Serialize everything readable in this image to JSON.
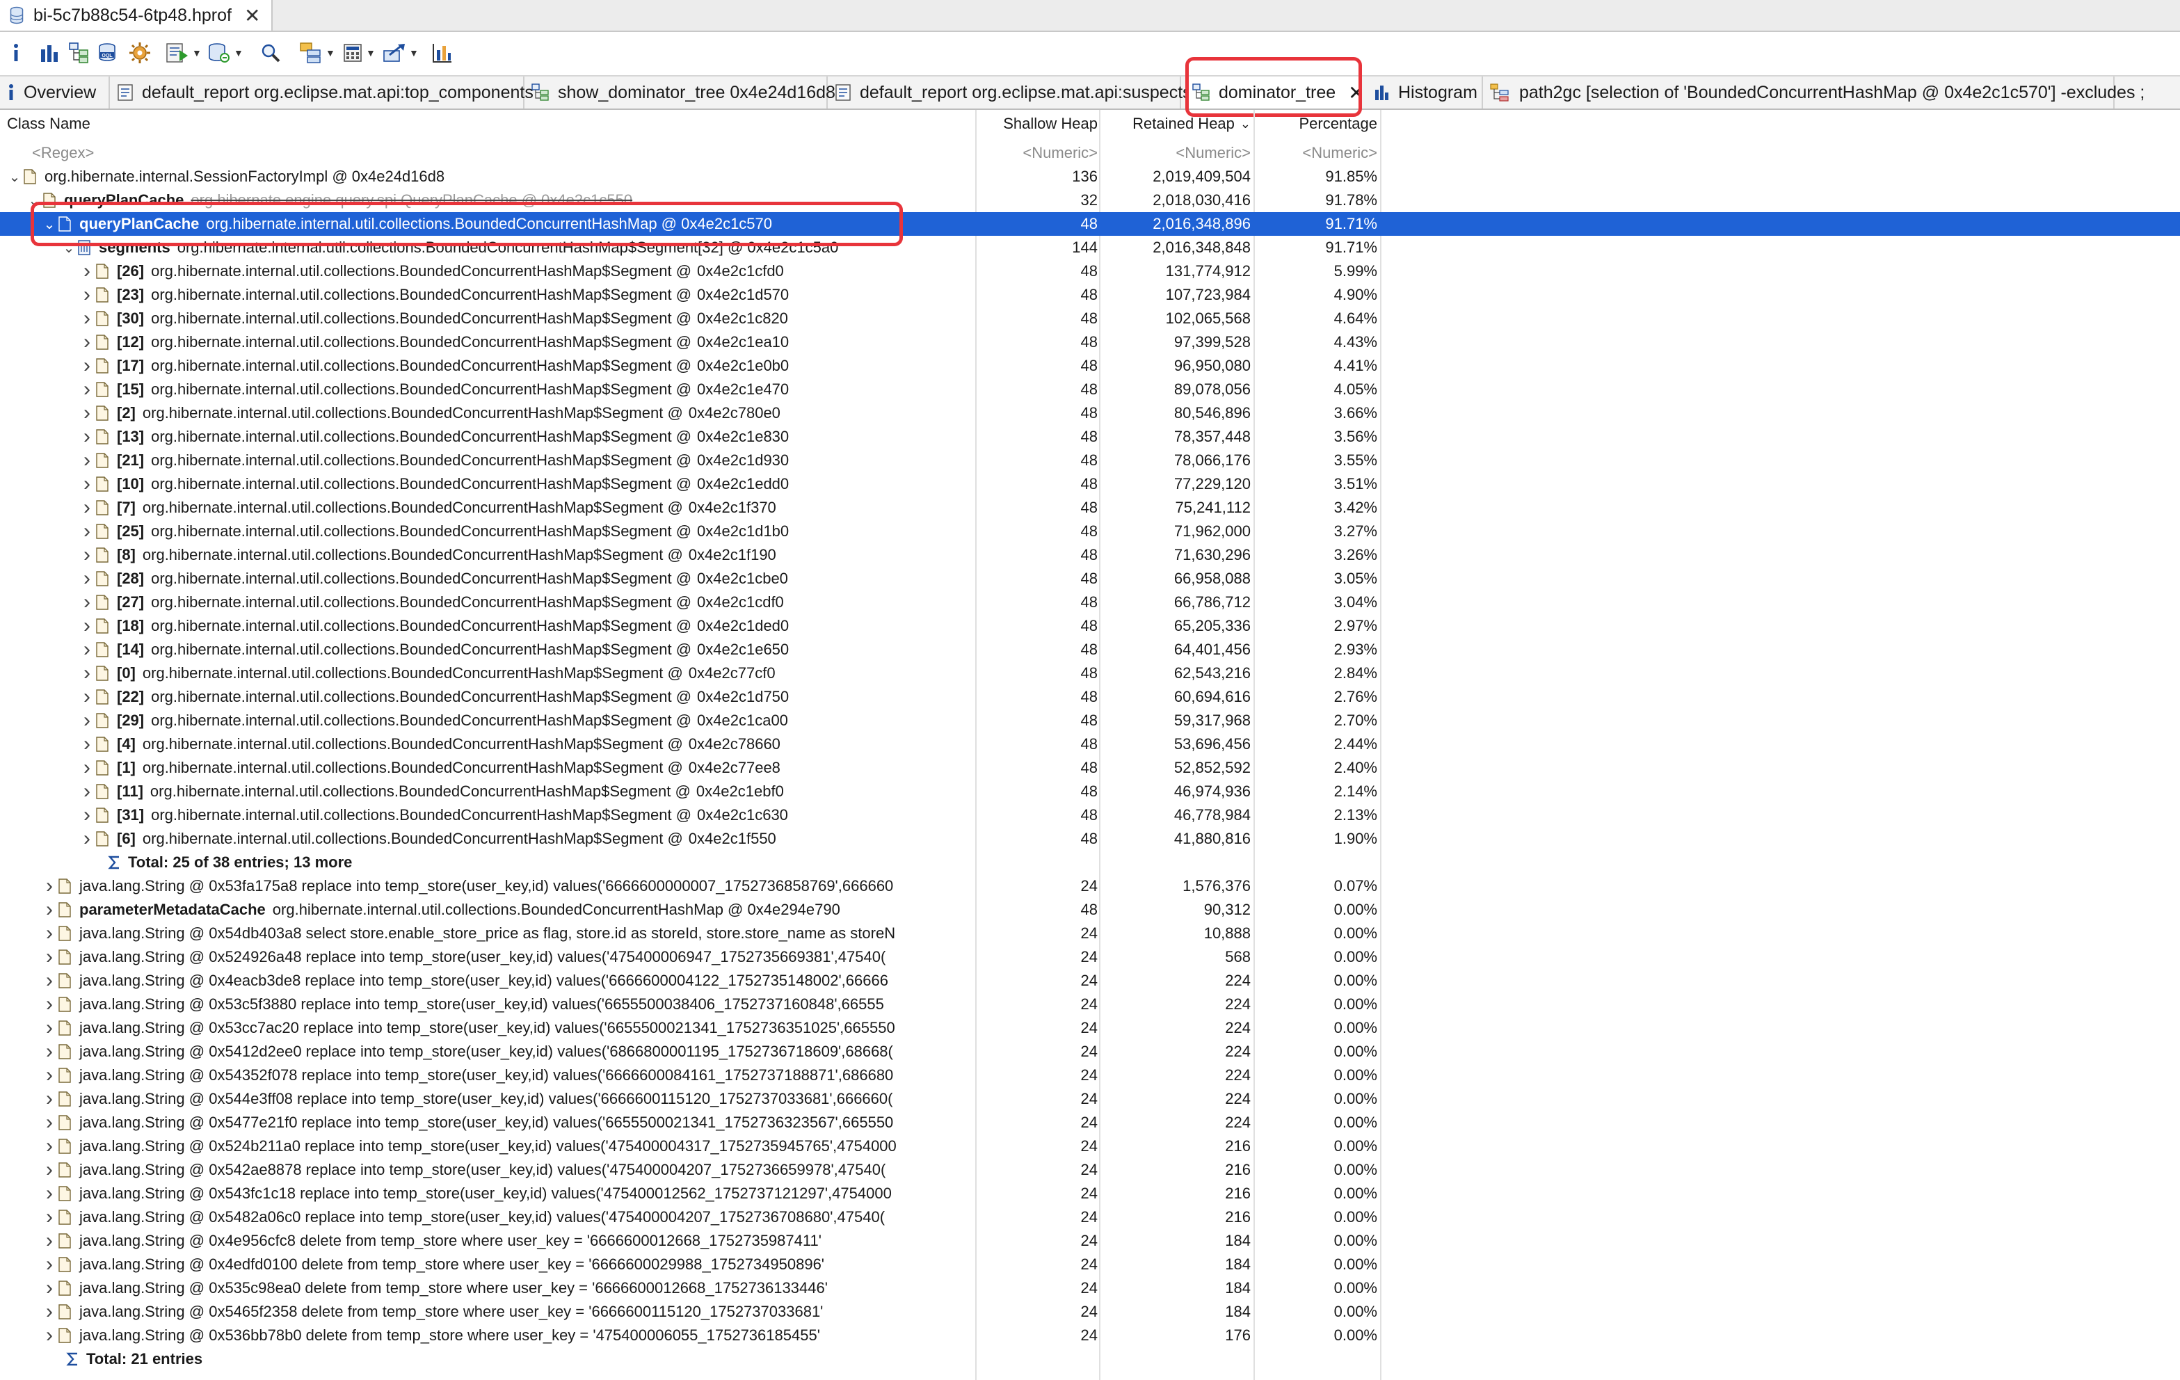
{
  "editor": {
    "file_tab": "bi-5c7b88c54-6tp48.hprof",
    "close_glyph": "✕"
  },
  "toolbar": {
    "icons": [
      "info-icon",
      "histogram-icon",
      "dominator-tree-icon",
      "oql-icon",
      "heap-dump-overview-icon",
      "run-report-icon",
      "query-browser-icon",
      "search-icon",
      "group-icon",
      "calculator-icon",
      "export-icon",
      "chart-icon"
    ]
  },
  "view_tabs": [
    {
      "label": "Overview"
    },
    {
      "label": "default_report org.eclipse.mat.api:top_components"
    },
    {
      "label": "show_dominator_tree 0x4e24d16d8"
    },
    {
      "label": "default_report org.eclipse.mat.api:suspects"
    },
    {
      "label": "dominator_tree"
    },
    {
      "label": "Histogram"
    },
    {
      "label": "path2gc [selection of 'BoundedConcurrentHashMap @ 0x4e2c1c570'] -excludes ;"
    }
  ],
  "columns": {
    "class_name": "Class Name",
    "shallow": "Shallow Heap",
    "retained": "Retained Heap",
    "percentage": "Percentage",
    "sort_glyph": "⌄"
  },
  "filter_row": {
    "regex": "<Regex>",
    "numeric": "<Numeric>"
  },
  "root_row": {
    "name": "org.hibernate.internal.SessionFactoryImpl @ 0x4e24d16d8",
    "shallow": "136",
    "retained": "2,019,409,504",
    "pct": "91.85%"
  },
  "query_plan_cache_row": {
    "field": "queryPlanCache",
    "name": "org.hibernate.engine.query.spi.QueryPlanCache @ 0x4e2c1c550",
    "shallow": "32",
    "retained": "2,018,030,416",
    "pct": "91.78%"
  },
  "selected_row": {
    "field": "queryPlanCache",
    "name": "org.hibernate.internal.util.collections.BoundedConcurrentHashMap @ 0x4e2c1c570",
    "shallow": "48",
    "retained": "2,016,348,896",
    "pct": "91.71%"
  },
  "segments_row": {
    "field": "segments",
    "name": "org.hibernate.internal.util.collections.BoundedConcurrentHashMap$Segment[32] @ 0x4e2c1c5a0",
    "shallow": "144",
    "retained": "2,016,348,848",
    "pct": "91.71%"
  },
  "segment_prefix": "org.hibernate.internal.util.collections.BoundedConcurrentHashMap$Segment @",
  "segments": [
    {
      "idx": "[26]",
      "addr": "0x4e2c1cfd0",
      "shallow": "48",
      "retained": "131,774,912",
      "pct": "5.99%"
    },
    {
      "idx": "[23]",
      "addr": "0x4e2c1d570",
      "shallow": "48",
      "retained": "107,723,984",
      "pct": "4.90%"
    },
    {
      "idx": "[30]",
      "addr": "0x4e2c1c820",
      "shallow": "48",
      "retained": "102,065,568",
      "pct": "4.64%"
    },
    {
      "idx": "[12]",
      "addr": "0x4e2c1ea10",
      "shallow": "48",
      "retained": "97,399,528",
      "pct": "4.43%"
    },
    {
      "idx": "[17]",
      "addr": "0x4e2c1e0b0",
      "shallow": "48",
      "retained": "96,950,080",
      "pct": "4.41%"
    },
    {
      "idx": "[15]",
      "addr": "0x4e2c1e470",
      "shallow": "48",
      "retained": "89,078,056",
      "pct": "4.05%"
    },
    {
      "idx": "[2]",
      "addr": "0x4e2c780e0",
      "shallow": "48",
      "retained": "80,546,896",
      "pct": "3.66%"
    },
    {
      "idx": "[13]",
      "addr": "0x4e2c1e830",
      "shallow": "48",
      "retained": "78,357,448",
      "pct": "3.56%"
    },
    {
      "idx": "[21]",
      "addr": "0x4e2c1d930",
      "shallow": "48",
      "retained": "78,066,176",
      "pct": "3.55%"
    },
    {
      "idx": "[10]",
      "addr": "0x4e2c1edd0",
      "shallow": "48",
      "retained": "77,229,120",
      "pct": "3.51%"
    },
    {
      "idx": "[7]",
      "addr": "0x4e2c1f370",
      "shallow": "48",
      "retained": "75,241,112",
      "pct": "3.42%"
    },
    {
      "idx": "[25]",
      "addr": "0x4e2c1d1b0",
      "shallow": "48",
      "retained": "71,962,000",
      "pct": "3.27%"
    },
    {
      "idx": "[8]",
      "addr": "0x4e2c1f190",
      "shallow": "48",
      "retained": "71,630,296",
      "pct": "3.26%"
    },
    {
      "idx": "[28]",
      "addr": "0x4e2c1cbe0",
      "shallow": "48",
      "retained": "66,958,088",
      "pct": "3.05%"
    },
    {
      "idx": "[27]",
      "addr": "0x4e2c1cdf0",
      "shallow": "48",
      "retained": "66,786,712",
      "pct": "3.04%"
    },
    {
      "idx": "[18]",
      "addr": "0x4e2c1ded0",
      "shallow": "48",
      "retained": "65,205,336",
      "pct": "2.97%"
    },
    {
      "idx": "[14]",
      "addr": "0x4e2c1e650",
      "shallow": "48",
      "retained": "64,401,456",
      "pct": "2.93%"
    },
    {
      "idx": "[0]",
      "addr": "0x4e2c77cf0",
      "shallow": "48",
      "retained": "62,543,216",
      "pct": "2.84%"
    },
    {
      "idx": "[22]",
      "addr": "0x4e2c1d750",
      "shallow": "48",
      "retained": "60,694,616",
      "pct": "2.76%"
    },
    {
      "idx": "[29]",
      "addr": "0x4e2c1ca00",
      "shallow": "48",
      "retained": "59,317,968",
      "pct": "2.70%"
    },
    {
      "idx": "[4]",
      "addr": "0x4e2c78660",
      "shallow": "48",
      "retained": "53,696,456",
      "pct": "2.44%"
    },
    {
      "idx": "[1]",
      "addr": "0x4e2c77ee8",
      "shallow": "48",
      "retained": "52,852,592",
      "pct": "2.40%"
    },
    {
      "idx": "[11]",
      "addr": "0x4e2c1ebf0",
      "shallow": "48",
      "retained": "46,974,936",
      "pct": "2.14%"
    },
    {
      "idx": "[31]",
      "addr": "0x4e2c1c630",
      "shallow": "48",
      "retained": "46,778,984",
      "pct": "2.13%"
    },
    {
      "idx": "[6]",
      "addr": "0x4e2c1f550",
      "shallow": "48",
      "retained": "41,880,816",
      "pct": "1.90%"
    }
  ],
  "segments_total": "Total: 25 of 38 entries; 13 more",
  "other_rows": [
    {
      "field": "",
      "name": "java.lang.String @ 0x53fa175a8  replace into temp_store(user_key,id) values('6666600000007_1752736858769',666660",
      "shallow": "24",
      "retained": "1,576,376",
      "pct": "0.07%"
    },
    {
      "field": "parameterMetadataCache",
      "name": "org.hibernate.internal.util.collections.BoundedConcurrentHashMap @ 0x4e294e790",
      "shallow": "48",
      "retained": "90,312",
      "pct": "0.00%"
    },
    {
      "field": "",
      "name": "java.lang.String @ 0x54db403a8  select store.enable_store_price as flag, store.id as storeId, store.store_name as storeN",
      "shallow": "24",
      "retained": "10,888",
      "pct": "0.00%"
    },
    {
      "field": "",
      "name": "java.lang.String @ 0x524926a48  replace into temp_store(user_key,id) values('475400006947_1752735669381',47540(",
      "shallow": "24",
      "retained": "568",
      "pct": "0.00%"
    },
    {
      "field": "",
      "name": "java.lang.String @ 0x4eacb3de8  replace into temp_store(user_key,id) values('6666600004122_1752735148002',66666",
      "shallow": "24",
      "retained": "224",
      "pct": "0.00%"
    },
    {
      "field": "",
      "name": "java.lang.String @ 0x53c5f3880  replace into temp_store(user_key,id) values('6655500038406_1752737160848',66555",
      "shallow": "24",
      "retained": "224",
      "pct": "0.00%"
    },
    {
      "field": "",
      "name": "java.lang.String @ 0x53cc7ac20  replace into temp_store(user_key,id) values('6655500021341_1752736351025',665550",
      "shallow": "24",
      "retained": "224",
      "pct": "0.00%"
    },
    {
      "field": "",
      "name": "java.lang.String @ 0x5412d2ee0  replace into temp_store(user_key,id) values('6866800001195_1752736718609',68668(",
      "shallow": "24",
      "retained": "224",
      "pct": "0.00%"
    },
    {
      "field": "",
      "name": "java.lang.String @ 0x54352f078  replace into temp_store(user_key,id) values('6666600084161_1752737188871',686680",
      "shallow": "24",
      "retained": "224",
      "pct": "0.00%"
    },
    {
      "field": "",
      "name": "java.lang.String @ 0x544e3ff08  replace into temp_store(user_key,id) values('6666600115120_1752737033681',666660(",
      "shallow": "24",
      "retained": "224",
      "pct": "0.00%"
    },
    {
      "field": "",
      "name": "java.lang.String @ 0x5477e21f0  replace into temp_store(user_key,id) values('6655500021341_1752736323567',665550",
      "shallow": "24",
      "retained": "224",
      "pct": "0.00%"
    },
    {
      "field": "",
      "name": "java.lang.String @ 0x524b211a0  replace into temp_store(user_key,id) values('475400004317_1752735945765',4754000",
      "shallow": "24",
      "retained": "216",
      "pct": "0.00%"
    },
    {
      "field": "",
      "name": "java.lang.String @ 0x542ae8878  replace into temp_store(user_key,id) values('475400004207_1752736659978',47540(",
      "shallow": "24",
      "retained": "216",
      "pct": "0.00%"
    },
    {
      "field": "",
      "name": "java.lang.String @ 0x543fc1c18  replace into temp_store(user_key,id) values('475400012562_1752737121297',4754000",
      "shallow": "24",
      "retained": "216",
      "pct": "0.00%"
    },
    {
      "field": "",
      "name": "java.lang.String @ 0x5482a06c0  replace into temp_store(user_key,id) values('475400004207_1752736708680',47540(",
      "shallow": "24",
      "retained": "216",
      "pct": "0.00%"
    },
    {
      "field": "",
      "name": "java.lang.String @ 0x4e956cfc8  delete from temp_store where user_key = '6666600012668_1752735987411'",
      "shallow": "24",
      "retained": "184",
      "pct": "0.00%"
    },
    {
      "field": "",
      "name": "java.lang.String @ 0x4edfd0100  delete from temp_store where user_key = '6666600029988_1752734950896'",
      "shallow": "24",
      "retained": "184",
      "pct": "0.00%"
    },
    {
      "field": "",
      "name": "java.lang.String @ 0x535c98ea0  delete from temp_store where user_key = '6666600012668_1752736133446'",
      "shallow": "24",
      "retained": "184",
      "pct": "0.00%"
    },
    {
      "field": "",
      "name": "java.lang.String @ 0x5465f2358  delete from temp_store where user_key = '6666600115120_1752737033681'",
      "shallow": "24",
      "retained": "184",
      "pct": "0.00%"
    },
    {
      "field": "",
      "name": "java.lang.String @ 0x536bb78b0  delete from temp_store where user_key = '475400006055_1752736185455'",
      "shallow": "24",
      "retained": "176",
      "pct": "0.00%"
    }
  ],
  "outer_total": "Total: 21 entries",
  "colors": {
    "selection": "#1f62d6",
    "highlight_box": "#e8343b"
  }
}
